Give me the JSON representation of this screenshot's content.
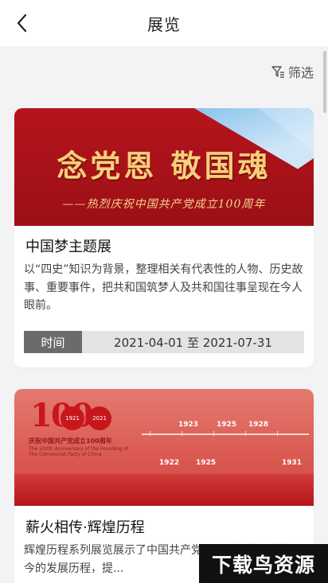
{
  "header": {
    "title": "展览",
    "back_icon": "chevron-left-icon"
  },
  "filter": {
    "label": "筛选",
    "icon": "filter-icon"
  },
  "exhibitions": [
    {
      "banner": {
        "slogan": "念党恩  敬国魂",
        "subtitle": "——热烈庆祝中国共产党成立100周年"
      },
      "title": "中国梦主题展",
      "description": "以“四史”知识为背景，整理相关有代表性的人物、历史故事、重要事件，把共和国筑梦人及共和国往事呈现在今人眼前。",
      "time_label": "时间",
      "time_range": "2021-04-01 至 2021-07-31"
    },
    {
      "banner": {
        "big_number": "100",
        "seal_left": "1921",
        "seal_right": "2021",
        "anniversary_cn": "庆祝中国共产党成立100周年",
        "anniversary_en": "The 100th Anniversary of the Founding of The Communist Party of China",
        "years_top": [
          "1923",
          "1925",
          "1928"
        ],
        "years_bottom": [
          "1922",
          "1925",
          "1931"
        ]
      },
      "title": "薪火相传·辉煌历程",
      "description": "辉煌历程系列展览展示了中国共产党...程，新中国成立至今的发展历程，提..."
    }
  ],
  "watermark": {
    "text": "下载鸟资源"
  },
  "colors": {
    "accent_red": "#b5141b",
    "time_label_bg": "#6b6b6b",
    "time_value_bg": "#e3e3e3"
  }
}
